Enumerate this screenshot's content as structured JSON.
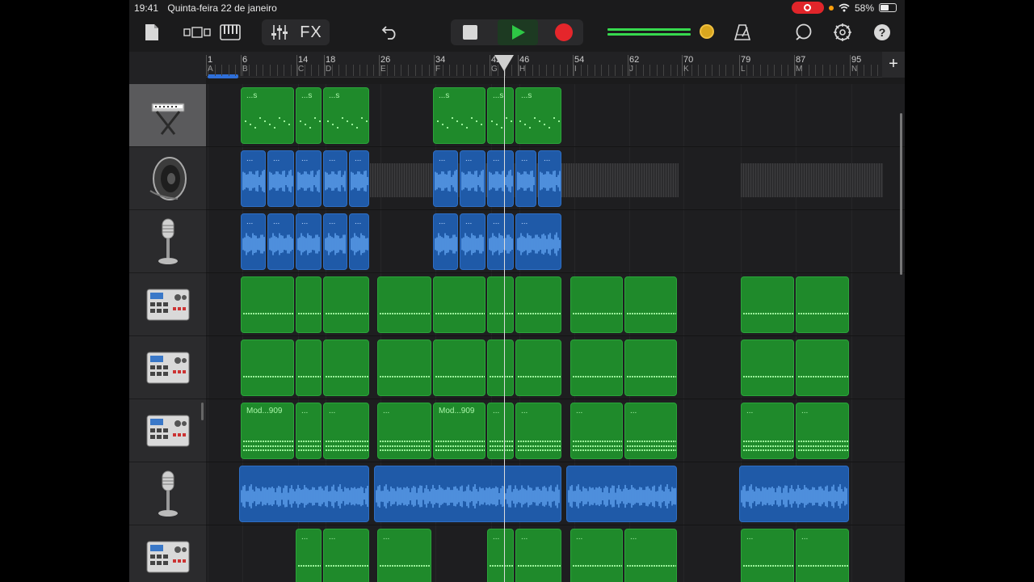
{
  "status": {
    "time": "19:41",
    "date": "Quinta-feira 22 de janeiro",
    "battery": "58%",
    "battery_level": 0.58
  },
  "toolbar": {
    "fx_label": "FX",
    "meter_level": 0.97
  },
  "ruler": {
    "marks": [
      {
        "bar": "1",
        "section": "A"
      },
      {
        "bar": "6",
        "section": "B"
      },
      {
        "bar": "14",
        "section": "C"
      },
      {
        "bar": "18",
        "section": "D"
      },
      {
        "bar": "26",
        "section": "E"
      },
      {
        "bar": "34",
        "section": "F"
      },
      {
        "bar": "42",
        "section": "G"
      },
      {
        "bar": "46",
        "section": "H"
      },
      {
        "bar": "54",
        "section": "I"
      },
      {
        "bar": "62",
        "section": "J"
      },
      {
        "bar": "70",
        "section": "K"
      },
      {
        "bar": "79",
        "section": "L"
      },
      {
        "bar": "87",
        "section": "M"
      },
      {
        "bar": "95",
        "section": "N"
      }
    ],
    "add_label": "+"
  },
  "tracks": [
    {
      "instrument": "keyboard-icon",
      "selected": true,
      "region_label": "...s"
    },
    {
      "instrument": "speaker-icon",
      "selected": false,
      "region_label": "..."
    },
    {
      "instrument": "microphone-icon",
      "selected": false,
      "region_label": "..."
    },
    {
      "instrument": "drum-machine-icon",
      "selected": false,
      "region_label": ""
    },
    {
      "instrument": "drum-machine-icon",
      "selected": false,
      "region_label": ""
    },
    {
      "instrument": "drum-machine-icon",
      "selected": false,
      "region_label": "Mod...909",
      "region_label_alt": "..."
    },
    {
      "instrument": "microphone-icon",
      "selected": false,
      "region_label": ""
    },
    {
      "instrument": "drum-machine-icon",
      "selected": false,
      "region_label": "..."
    }
  ],
  "colors": {
    "midi_region": "#1f8a2b",
    "audio_region": "#1f5aa8",
    "record": "#e5262b",
    "play": "#2ec845",
    "accent_meter": "#37d94e"
  }
}
